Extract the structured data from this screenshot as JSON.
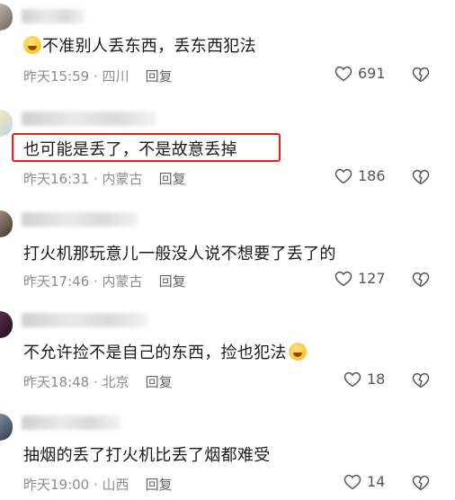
{
  "comments": [
    {
      "text": "不准别人丢东西，丢东西犯法",
      "emoji_before": true,
      "emoji_after": false,
      "time": "昨天15:59",
      "location": "四川",
      "reply": "回复",
      "likes": "691",
      "highlighted": false
    },
    {
      "text": "也可能是丢了，不是故意丢掉",
      "emoji_before": false,
      "emoji_after": false,
      "time": "昨天16:31",
      "location": "内蒙古",
      "reply": "回复",
      "likes": "186",
      "highlighted": true
    },
    {
      "text": "打火机那玩意儿一般没人说不想要了丢了的",
      "emoji_before": false,
      "emoji_after": false,
      "time": "昨天17:46",
      "location": "内蒙古",
      "reply": "回复",
      "likes": "127",
      "highlighted": false
    },
    {
      "text": "不允许捡不是自己的东西，捡也犯法",
      "emoji_before": false,
      "emoji_after": true,
      "time": "昨天18:48",
      "location": "北京",
      "reply": "回复",
      "likes": "18",
      "highlighted": false
    },
    {
      "text": "抽烟的丢了打火机比丢了烟都难受",
      "emoji_before": false,
      "emoji_after": false,
      "time": "昨天19:00",
      "location": "山西",
      "reply": "回复",
      "likes": "14",
      "highlighted": false
    }
  ],
  "icons": {
    "like": "heart-outline-icon",
    "dislike": "broken-heart-icon",
    "emoji": "laughing-emoji-icon"
  },
  "colors": {
    "highlight": "#e8201d",
    "text": "#1a1a1a",
    "meta": "#8c8c8c"
  }
}
